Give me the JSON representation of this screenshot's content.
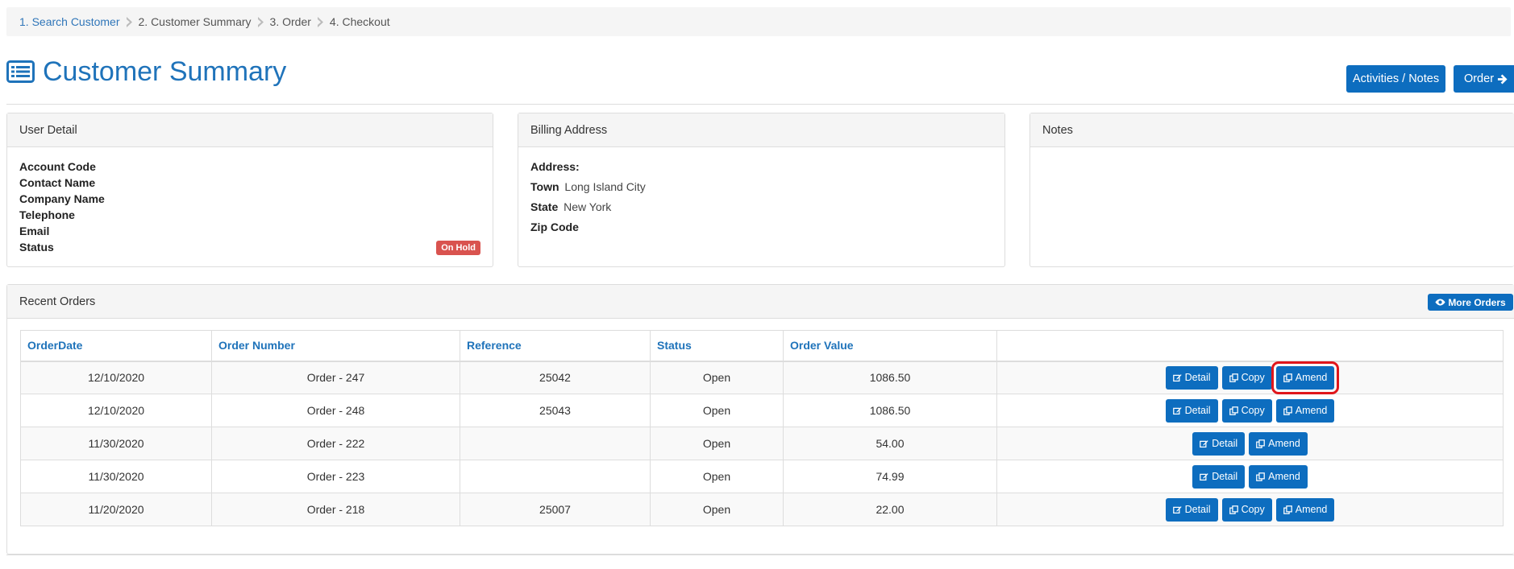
{
  "breadcrumb": [
    {
      "label": "1. Search Customer"
    },
    {
      "label": "2. Customer Summary"
    },
    {
      "label": "3. Order"
    },
    {
      "label": "4. Checkout"
    }
  ],
  "header": {
    "title": "Customer Summary",
    "title_icon": "list-icon",
    "activities_label": "Activities / Notes",
    "order_label": "Order"
  },
  "user_detail": {
    "heading": "User Detail",
    "account_code": "Account Code",
    "contact_name": "Contact Name",
    "company_name": "Company Name",
    "telephone": "Telephone",
    "email": "Email",
    "status": "Status",
    "status_badge": "On Hold"
  },
  "billing": {
    "heading": "Billing Address",
    "address_label": "Address:",
    "town_label": "Town",
    "town_value": "Long Island City",
    "state_label": "State",
    "state_value": "New York",
    "zip_label": "Zip Code"
  },
  "notes": {
    "heading": "Notes"
  },
  "orders": {
    "heading": "Recent Orders",
    "more_label": "More Orders",
    "columns": [
      "OrderDate",
      "Order Number",
      "Reference",
      "Status",
      "Order Value",
      ""
    ],
    "detail_label": "Detail",
    "copy_label": "Copy",
    "amend_label": "Amend",
    "rows": [
      {
        "date": "12/10/2020",
        "number": "Order - 247",
        "reference": "25042",
        "status": "Open",
        "value": "1086.50",
        "copy": true,
        "highlight": true
      },
      {
        "date": "12/10/2020",
        "number": "Order - 248",
        "reference": "25043",
        "status": "Open",
        "value": "1086.50",
        "copy": true,
        "highlight": false
      },
      {
        "date": "11/30/2020",
        "number": "Order - 222",
        "reference": "",
        "status": "Open",
        "value": "54.00",
        "copy": false,
        "highlight": false
      },
      {
        "date": "11/30/2020",
        "number": "Order - 223",
        "reference": "",
        "status": "Open",
        "value": "74.99",
        "copy": false,
        "highlight": false
      },
      {
        "date": "11/20/2020",
        "number": "Order - 218",
        "reference": "25007",
        "status": "Open",
        "value": "22.00",
        "copy": true,
        "highlight": false
      }
    ]
  },
  "colors": {
    "primary": "#0d6dbf",
    "title": "#1f73ba",
    "danger": "#d9534f",
    "highlight": "#e0161b"
  }
}
